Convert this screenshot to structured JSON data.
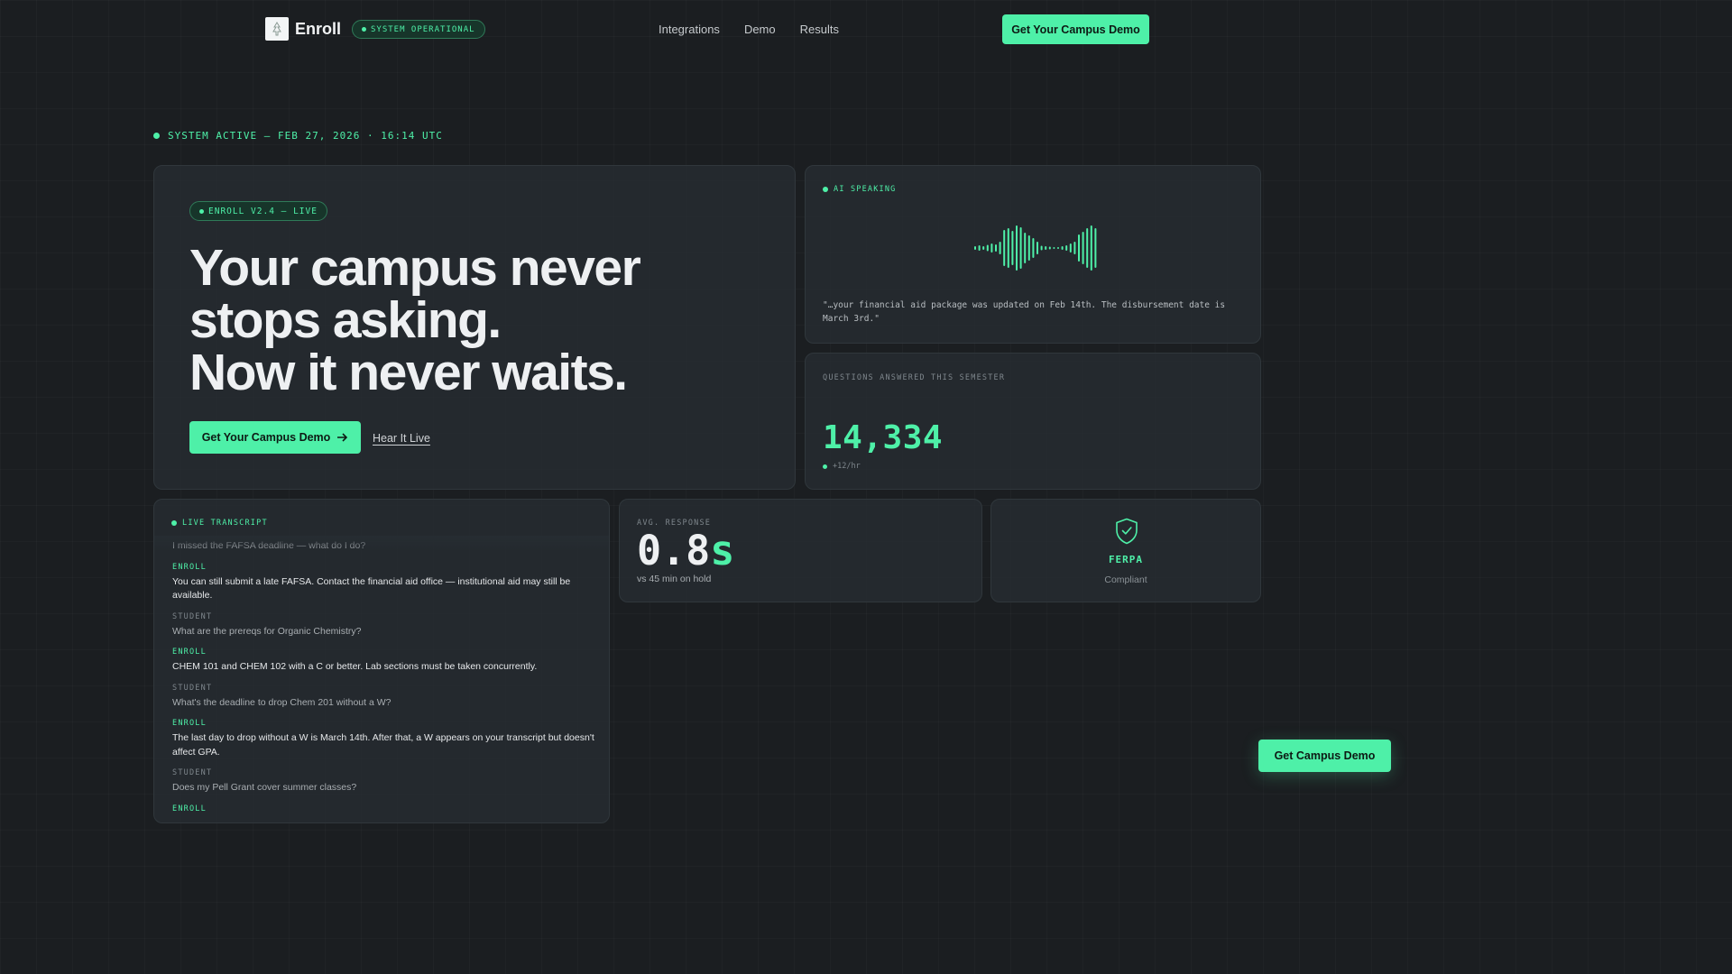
{
  "nav": {
    "brand": "Enroll",
    "status_pill": "SYSTEM OPERATIONAL",
    "links": [
      "Integrations",
      "Demo",
      "Results"
    ],
    "cta": "Get Your Campus Demo"
  },
  "status_line": "SYSTEM ACTIVE — FEB 27, 2026 · 16:14 UTC",
  "hero": {
    "pill": "ENROLL V2.4 — LIVE",
    "headline": [
      "Your campus never",
      "stops asking.",
      "Now it never waits."
    ],
    "cta": "Get Your Campus Demo",
    "secondary_link": "Hear It Live"
  },
  "ai_speaking": {
    "label": "AI SPEAKING",
    "quote": "\"…your financial aid package was updated on Feb 14th. The disbursement date is March 3rd.\""
  },
  "questions": {
    "label": "QUESTIONS ANSWERED THIS SEMESTER",
    "value": "14,334",
    "rate": "+12/hr"
  },
  "transcript": {
    "label": "LIVE TRANSCRIPT",
    "first_line": "I missed the FAFSA deadline — what do I do?",
    "messages": [
      {
        "speaker": "ENROLL",
        "role": "enroll",
        "text": "You can still submit a late FAFSA. Contact the financial aid office — institutional aid may still be available."
      },
      {
        "speaker": "STUDENT",
        "role": "student",
        "text": "What are the prereqs for Organic Chemistry?"
      },
      {
        "speaker": "ENROLL",
        "role": "enroll",
        "text": "CHEM 101 and CHEM 102 with a C or better. Lab sections must be taken concurrently."
      },
      {
        "speaker": "STUDENT",
        "role": "student",
        "text": "What's the deadline to drop Chem 201 without a W?"
      },
      {
        "speaker": "ENROLL",
        "role": "enroll",
        "text": "The last day to drop without a W is March 14th. After that, a W appears on your transcript but doesn't affect GPA."
      },
      {
        "speaker": "STUDENT",
        "role": "student",
        "text": "Does my Pell Grant cover summer classes?"
      },
      {
        "speaker": "ENROLL",
        "role": "enroll",
        "text": ""
      }
    ]
  },
  "avg_response": {
    "label": "AVG. RESPONSE",
    "value": "0.8",
    "unit": "s",
    "sub": "vs 45 min on hold"
  },
  "ferpa": {
    "icon": "shield-check-icon",
    "title": "FERPA",
    "sub": "Compliant"
  },
  "float_cta": "Get Campus Demo",
  "colors": {
    "accent": "#4ef0a8",
    "background": "#1b1e21",
    "card": "#262d32"
  }
}
